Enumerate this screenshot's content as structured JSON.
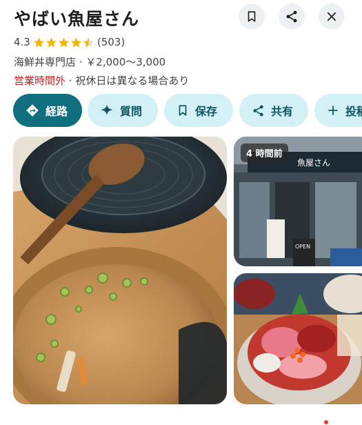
{
  "place": {
    "name": "やばい魚屋さん",
    "rating": "4.3",
    "stars_value": 4.3,
    "review_count": "(503)",
    "category_price": "海鮮丼専門店 · ￥2,000〜3,000",
    "hours_status": "営業時間外",
    "hours_note": " · 祝休日は異なる場合あり"
  },
  "header": {
    "icons": [
      "bookmark-icon",
      "share-icon",
      "close-icon"
    ]
  },
  "actions": [
    {
      "label": "経路",
      "icon": "directions-icon"
    },
    {
      "label": "質問",
      "icon": "sparkle-icon"
    },
    {
      "label": "保存",
      "icon": "bookmark-icon"
    },
    {
      "label": "共有",
      "icon": "share-icon"
    },
    {
      "label": "投稿",
      "icon": "plus-icon"
    }
  ],
  "photos": {
    "storefront_badge": "4 時間前",
    "sign_text": "魚屋さん",
    "board_text": "OPEN"
  },
  "colors": {
    "primary": "#0f6f7e",
    "chip_bg": "#d3f0f6",
    "closed": "#c5221f",
    "star": "#f6b300"
  }
}
